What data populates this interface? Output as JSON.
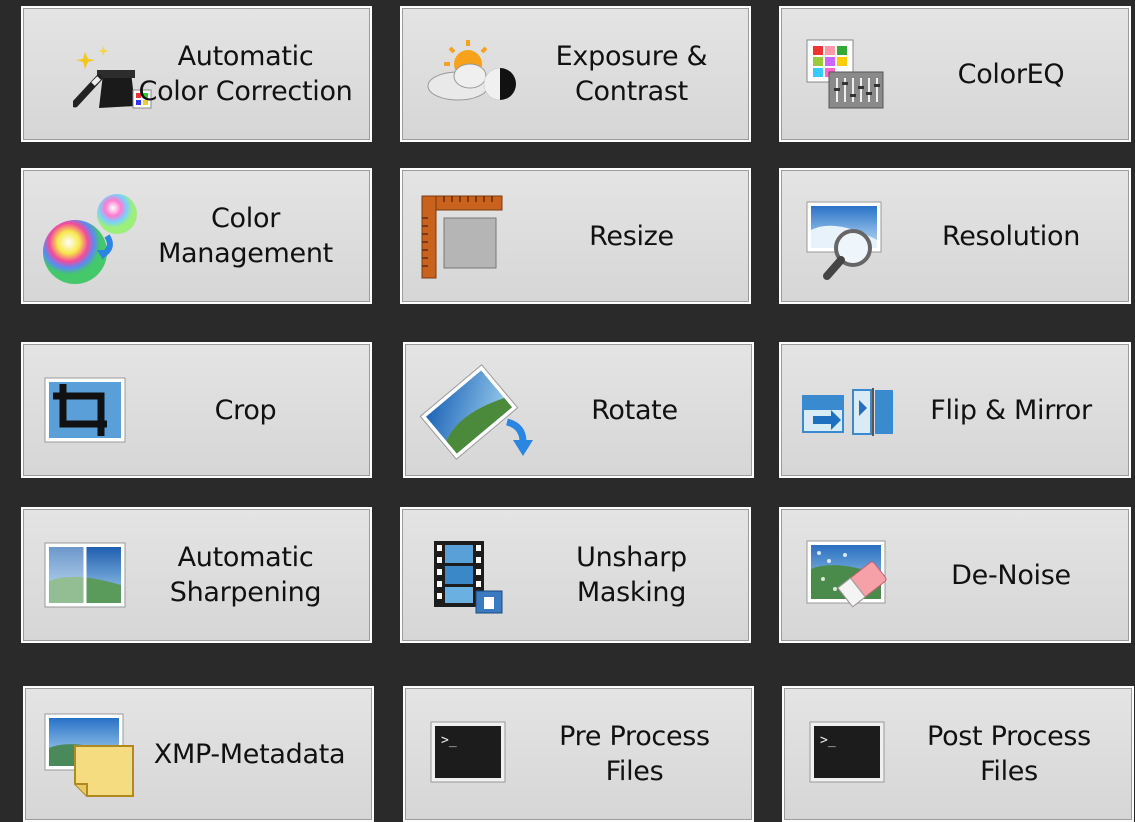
{
  "tiles": [
    {
      "label": "Automatic\nColor Correction",
      "icon": "magic-wand-icon"
    },
    {
      "label": "Exposure &\nContrast",
      "icon": "sun-cloud-icon"
    },
    {
      "label": "ColorEQ",
      "icon": "color-equalizer-icon"
    },
    {
      "label": "Color\nManagement",
      "icon": "color-spheres-icon"
    },
    {
      "label": "Resize",
      "icon": "ruler-icon"
    },
    {
      "label": "Resolution",
      "icon": "magnifier-icon"
    },
    {
      "label": "Crop",
      "icon": "crop-icon"
    },
    {
      "label": "Rotate",
      "icon": "rotate-icon"
    },
    {
      "label": "Flip & Mirror",
      "icon": "flip-mirror-icon"
    },
    {
      "label": "Automatic\nSharpening",
      "icon": "sharpen-icon"
    },
    {
      "label": "Unsharp\nMasking",
      "icon": "film-strip-icon"
    },
    {
      "label": "De-Noise",
      "icon": "eraser-icon"
    },
    {
      "label": "XMP-Metadata",
      "icon": "metadata-note-icon"
    },
    {
      "label": "Pre Process\nFiles",
      "icon": "terminal-icon"
    },
    {
      "label": "Post Process\nFiles",
      "icon": "terminal-icon"
    }
  ]
}
